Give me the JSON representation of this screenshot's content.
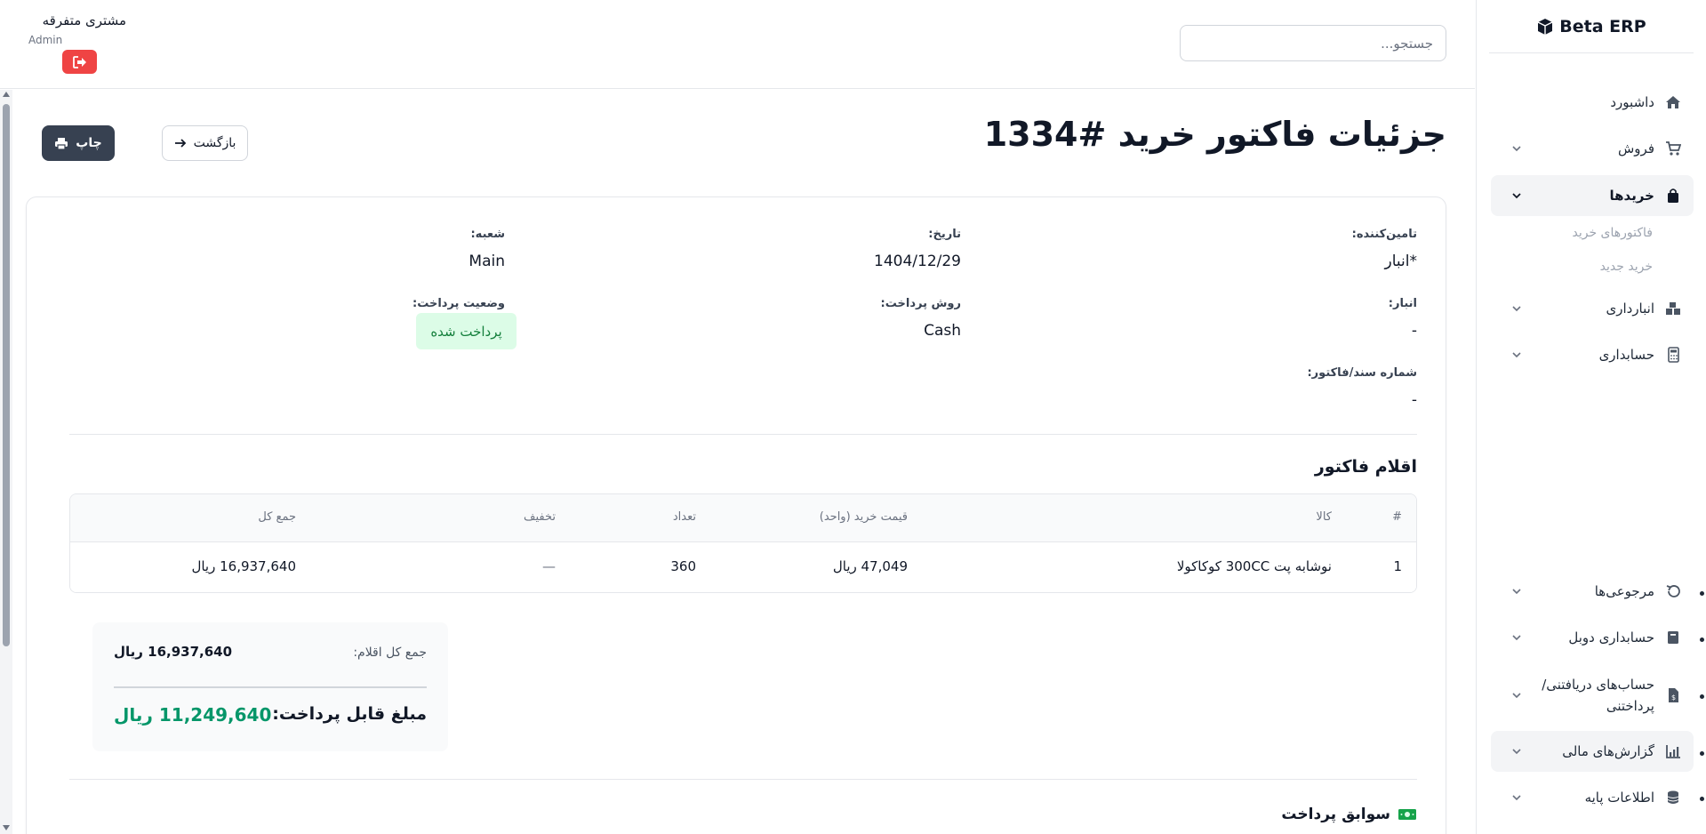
{
  "brand": {
    "name": "Beta ERP"
  },
  "sidebar": {
    "items": [
      {
        "label": "داشبورد"
      },
      {
        "label": "فروش"
      },
      {
        "label": "خریدها",
        "sub": [
          "فاکتورهای خرید",
          "خرید جدید"
        ]
      },
      {
        "label": "انبارداری"
      },
      {
        "label": "حسابداری"
      },
      {
        "label": "مرجوعی‌ها"
      },
      {
        "label": "حسابداری دوبل"
      },
      {
        "label": "حساب‌های دریافتنی/ پرداختنی"
      },
      {
        "label": "گزارش‌های مالی"
      },
      {
        "label": "اطلاعات پایه"
      }
    ]
  },
  "topbar": {
    "search_placeholder": "جستجو...",
    "user_name": "مشتری متفرقه",
    "user_role": "Admin"
  },
  "page": {
    "title": "جزئیات فاکتور خرید #1334",
    "back_label": "بازگشت",
    "print_label": "چاپ"
  },
  "invoice": {
    "supplier_label": "تامین‌کننده:",
    "supplier_value": "*انبار",
    "date_label": "تاریخ:",
    "date_value": "1404/12/29",
    "branch_label": "شعبه:",
    "branch_value": "Main",
    "warehouse_label": "انبار:",
    "warehouse_value": "-",
    "payment_method_label": "روش پرداخت:",
    "payment_method_value": "Cash",
    "payment_status_label": "وضعیت پرداخت:",
    "payment_status_value": "پرداخت شده",
    "doc_number_label": "شماره سند/فاکتور:",
    "doc_number_value": "-"
  },
  "items": {
    "title": "اقلام فاکتور",
    "headers": [
      "#",
      "کالا",
      "قیمت خرید (واحد)",
      "تعداد",
      "تخفیف",
      "جمع کل"
    ],
    "rows": [
      [
        "1",
        "نوشابه پت 300CC کوکاکولا",
        "47,049 ریال",
        "360",
        "—",
        "16,937,640 ریال"
      ]
    ]
  },
  "summary": {
    "items_total_label": "جمع کل اقلام:",
    "items_total_value": "16,937,640 ریال",
    "payable_label": "مبلغ قابل پرداخت:",
    "payable_value": "11,249,640 ریال"
  },
  "history": {
    "title": "سوابق پرداخت"
  },
  "colors": {
    "accent_dark": "#374151",
    "danger": "#ef4444",
    "success": "#059669",
    "badge_bg": "#dcfce7"
  }
}
